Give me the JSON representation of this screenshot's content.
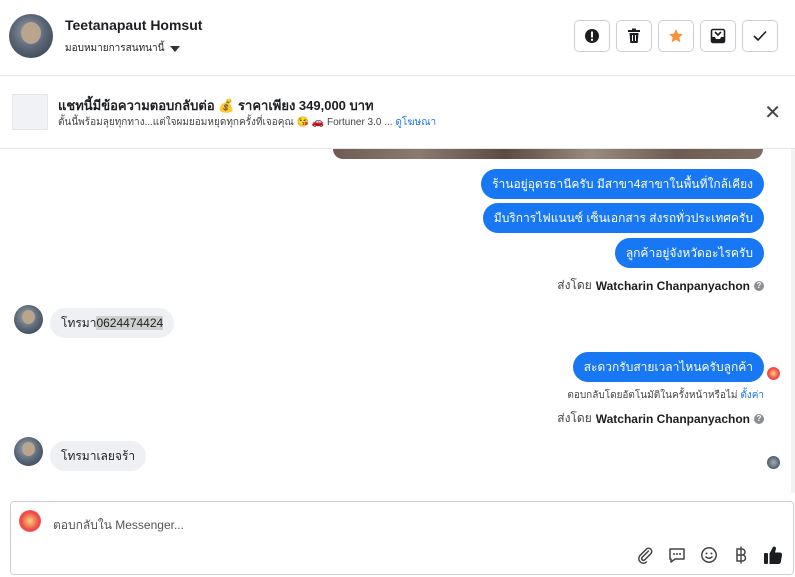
{
  "header": {
    "contact_name": "Teetanapaut Homsut",
    "assign_label": "มอบหมายการสนทนานี้",
    "actions": [
      {
        "name": "mark-spam-button",
        "icon": "alert-circle-icon"
      },
      {
        "name": "delete-button",
        "icon": "trash-icon"
      },
      {
        "name": "star-button",
        "icon": "star-icon"
      },
      {
        "name": "move-to-inbox-button",
        "icon": "inbox-icon"
      },
      {
        "name": "mark-done-button",
        "icon": "check-icon"
      }
    ]
  },
  "ad": {
    "title": "แชทนี้มีข้อความตอบกลับต่อ 💰 ราคาเพียง 349,000 บาท",
    "subtitle": "ตั้นนี้พร้อมลุยทุกทาง...แต่ใจผมยอมหยุดทุกครั้งที่เจอคุณ 😘 🚗 Fortuner 3.0 ...",
    "link": "ดูโฆษณา",
    "close_icon": "close-icon"
  },
  "messages": {
    "out1": "ร้านอยู่อุดรธานีครับ มีสาขา4สาขาในพื้นที่ใกล้เคียง",
    "out2": "มีบริการไฟแนนซ์ เซ็นเอกสาร ส่งรถทั่วประเทศครับ",
    "out3": "ลูกค้าอยู่จังหวัดอะไรครับ",
    "sent_by_1_prefix": "ส่งโดย",
    "sent_by_1_name": "Watcharin Chanpanyachon",
    "in1_prefix": "โทรมา",
    "in1_number": "0624474424",
    "out4": "สะดวกรับสายเวลาไหนครับลูกค้า",
    "auto_note": "ตอบกลับโดยอัตโนมัติในครั้งหน้าหรือไม่",
    "auto_link": "ตั้งค่า",
    "sent_by_2_prefix": "ส่งโดย",
    "sent_by_2_name": "Watcharin Chanpanyachon",
    "in2": "โทรมาเลยจร้า"
  },
  "composer": {
    "placeholder": "ตอบกลับใน Messenger...",
    "tools": [
      "attachment-icon",
      "saved-reply-icon",
      "emoji-icon",
      "baht-icon",
      "like-icon"
    ]
  },
  "colors": {
    "accent": "#1877f2",
    "incoming_bubble": "#eef0f3",
    "star": "#f7923a"
  }
}
